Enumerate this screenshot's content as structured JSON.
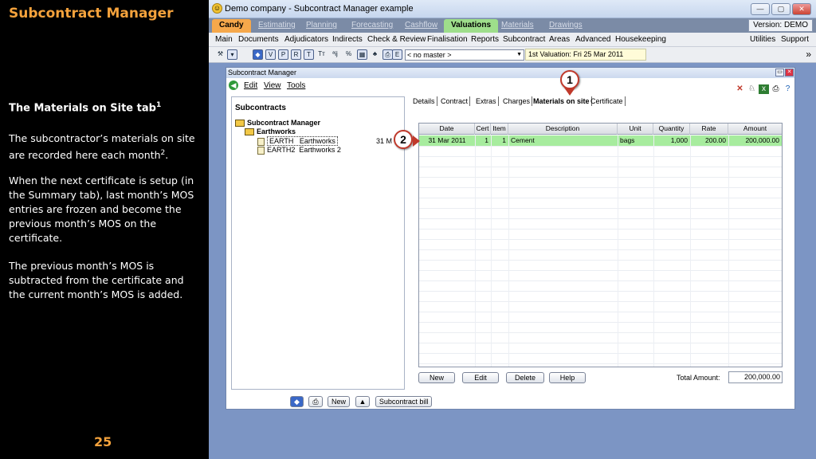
{
  "slide": {
    "title": "Subcontract Manager",
    "section_title": "The Materials on Site tab",
    "section_sup": "1",
    "p1": "The subcontractor’s materials on site are recorded here each month",
    "p1_sup": "2",
    "p1_end": ".",
    "p2": "When the next certificate is setup (in the Summary tab), last month’s MOS entries are frozen and become the previous month’s MOS on the certificate.",
    "p3": "The previous  month’s MOS is subtracted from the certificate  and the current month’s MOS is added.",
    "page_number": "25"
  },
  "app": {
    "window_title": "Demo company - Subcontract Manager example",
    "module_tabs": [
      "Candy",
      "Estimating",
      "Planning",
      "Forecasting",
      "Cashflow",
      "Valuations",
      "Materials",
      "Drawings"
    ],
    "active_module": "Valuations",
    "version": "Version: DEMO",
    "menu": [
      "Main",
      "Documents",
      "Adjudicators",
      "Indirects",
      "Check & Review",
      "Finalisation",
      "Reports",
      "Subcontract",
      "Areas",
      "Advanced",
      "Housekeeping"
    ],
    "menu_right": [
      "Utilities",
      "Support"
    ],
    "master_select": "< no master >",
    "valuation": "1st Valuation: Fri 25 Mar 2011"
  },
  "inner": {
    "title": "Subcontract Manager",
    "menu": [
      "Edit",
      "View",
      "Tools"
    ],
    "panel_title": "Subcontracts",
    "tree": {
      "root": "Subcontract Manager",
      "group": "Earthworks",
      "items": [
        {
          "code": "EARTH",
          "name": "Earthworks",
          "date": "31 M"
        },
        {
          "code": "EARTH2",
          "name": "Earthworks 2"
        }
      ]
    },
    "bottom_buttons": [
      "New",
      "Subcontract bill"
    ],
    "tabs": [
      "Details",
      "Contract",
      "Extras",
      "Charges",
      "Materials on site",
      "Certificate"
    ],
    "active_tab": "Materials on site",
    "grid": {
      "headers": [
        "Date",
        "Cert",
        "Item",
        "Description",
        "Unit",
        "Quantity",
        "Rate",
        "Amount"
      ],
      "rows": [
        [
          "31 Mar 2011",
          "1",
          "1",
          "Cement",
          "bags",
          "1,000",
          "200.00",
          "200,000.00"
        ]
      ]
    },
    "grid_buttons": [
      "New",
      "Edit",
      "Delete",
      "Help"
    ],
    "total_label": "Total Amount:",
    "total_value": "200,000.00"
  },
  "callouts": [
    "1",
    "2"
  ],
  "colors": {
    "accent": "#f4a23c",
    "selected_row": "#a7ec9e",
    "active_module": "#9ede8b",
    "candy_tab": "#f6a84b",
    "callout_border": "#c0392b"
  }
}
